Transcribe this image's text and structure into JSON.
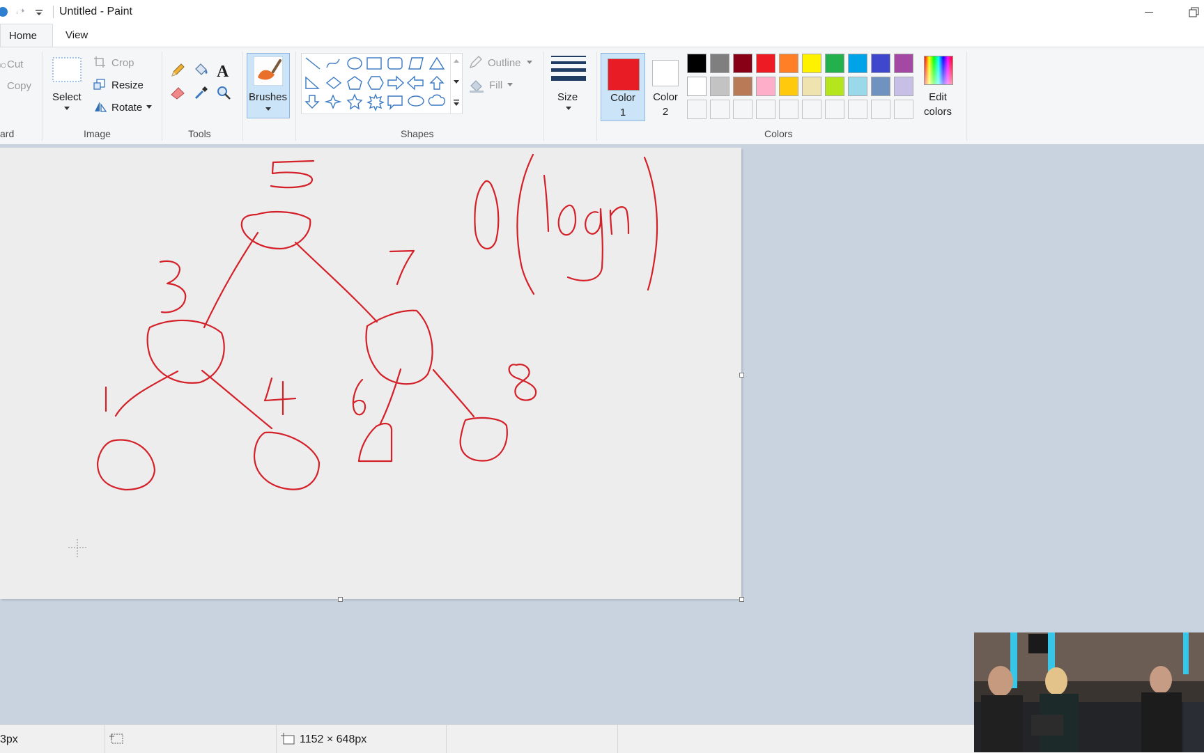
{
  "window": {
    "title": "Untitled - Paint"
  },
  "tabs": [
    {
      "label": "Home",
      "active": true
    },
    {
      "label": "View",
      "active": false
    }
  ],
  "ribbon": {
    "clipboard": {
      "cut": "Cut",
      "copy": "Copy",
      "group_label": "ard"
    },
    "image": {
      "select": "Select",
      "crop": "Crop",
      "resize": "Resize",
      "rotate": "Rotate",
      "group_label": "Image"
    },
    "tools": {
      "group_label": "Tools"
    },
    "brushes": {
      "label": "Brushes"
    },
    "shapes": {
      "outline": "Outline",
      "fill": "Fill",
      "group_label": "Shapes"
    },
    "size": {
      "label": "Size"
    },
    "colors": {
      "color1_label_line1": "Color",
      "color1_label_line2": "1",
      "color1_value": "#e81c24",
      "color2_label_line1": "Color",
      "color2_label_line2": "2",
      "color2_value": "#ffffff",
      "edit_colors_line1": "Edit",
      "edit_colors_line2": "colors",
      "group_label": "Colors",
      "palette_row1": [
        "#000000",
        "#7f7f7f",
        "#880015",
        "#ed1c24",
        "#ff7f27",
        "#fff200",
        "#22b14c",
        "#00a2e8",
        "#3f48cc",
        "#a349a4"
      ],
      "palette_row2": [
        "#ffffff",
        "#c3c3c3",
        "#b97a57",
        "#ffaec9",
        "#ffc90e",
        "#efe4b0",
        "#b5e61d",
        "#99d9ea",
        "#7092be",
        "#c8bfe7"
      ],
      "accent": "#e81c24"
    }
  },
  "canvas": {
    "ink_color": "#d42028",
    "labels": [
      "5",
      "3",
      "7",
      "1",
      "4",
      "6",
      "8",
      "O",
      "(",
      "logn",
      ")"
    ]
  },
  "statusbar": {
    "cursor_position": "3px",
    "canvas_size": "1152 × 648px"
  },
  "icons": {
    "qat": [
      "save-icon",
      "undo-icon",
      "redo-icon",
      "customize-qat-icon"
    ],
    "tools": [
      "pencil-icon",
      "fill-bucket-icon",
      "text-icon",
      "eraser-icon",
      "color-picker-icon",
      "magnifier-icon"
    ],
    "status": [
      "cursor-position-icon",
      "selection-size-icon",
      "canvas-size-icon"
    ]
  }
}
